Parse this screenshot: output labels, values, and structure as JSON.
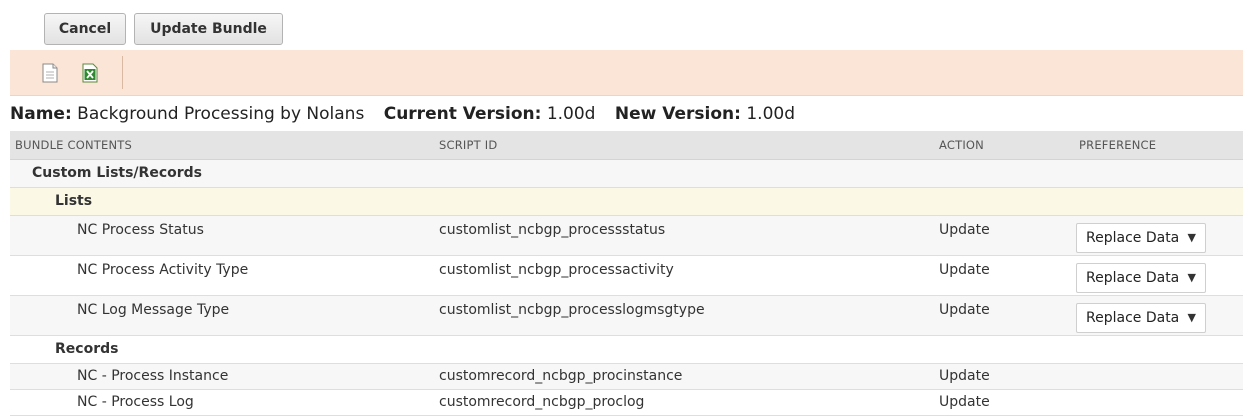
{
  "toolbar": {
    "cancel_label": "Cancel",
    "update_label": "Update Bundle"
  },
  "action_strip": {
    "icons": [
      "document-icon",
      "excel-export-icon"
    ]
  },
  "bundle": {
    "name_label": "Name:",
    "name_value": "Background Processing by Nolans",
    "current_version_label": "Current Version:",
    "current_version_value": "1.00d",
    "new_version_label": "New Version:",
    "new_version_value": "1.00d"
  },
  "table": {
    "headers": [
      "BUNDLE CONTENTS",
      "SCRIPT ID",
      "ACTION",
      "PREFERENCE"
    ],
    "group": "Custom Lists/Records",
    "lists_label": "Lists",
    "lists": [
      {
        "name": "NC Process Status",
        "script_id": "customlist_ncbgp_processstatus",
        "action": "Update",
        "preference": "Replace Data"
      },
      {
        "name": "NC Process Activity Type",
        "script_id": "customlist_ncbgp_processactivity",
        "action": "Update",
        "preference": "Replace Data"
      },
      {
        "name": "NC Log Message Type",
        "script_id": "customlist_ncbgp_processlogmsgtype",
        "action": "Update",
        "preference": "Replace Data"
      }
    ],
    "records_label": "Records",
    "records": [
      {
        "name": "NC - Process Instance",
        "script_id": "customrecord_ncbgp_procinstance",
        "action": "Update"
      },
      {
        "name": "NC - Process Log",
        "script_id": "customrecord_ncbgp_proclog",
        "action": "Update"
      }
    ]
  },
  "colors": {
    "strip_bg": "#fbe5d6",
    "header_bg": "#e4e4e4",
    "lists_row_bg": "#fbf9e6"
  }
}
